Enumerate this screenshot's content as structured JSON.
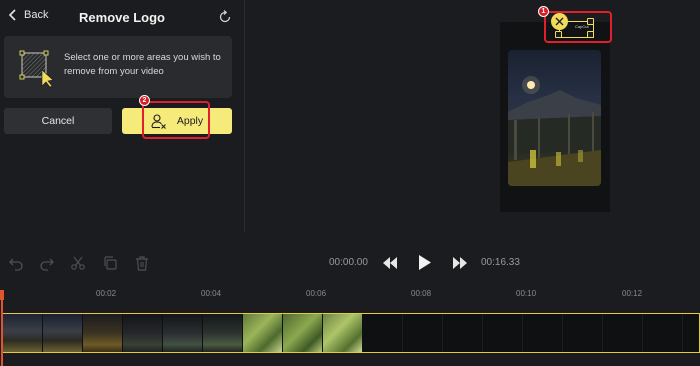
{
  "header": {
    "back_label": "Back",
    "title": "Remove Logo"
  },
  "info": {
    "text": "Select one or more areas you wish to remove from your video"
  },
  "buttons": {
    "cancel_label": "Cancel",
    "apply_label": "Apply"
  },
  "annotations": {
    "badge_1": "1",
    "badge_2": "2"
  },
  "preview": {
    "logo_text": "CapCut"
  },
  "playback": {
    "current_time": "00:00.00",
    "total_time": "00:16.33"
  },
  "ruler": {
    "labels": [
      "00:02",
      "00:04",
      "00:06",
      "00:08",
      "00:10",
      "00:12"
    ]
  },
  "colors": {
    "accent": "#f6ea7a",
    "highlight": "#e0202a",
    "playhead": "#e0552a",
    "track_border": "#e8c93a",
    "background": "#1b1c1f"
  },
  "icons": {
    "back": "chevron-left-icon",
    "reset": "refresh-icon",
    "area": "area-select-icon",
    "apply": "user-remove-icon",
    "undo": "undo-icon",
    "redo": "redo-icon",
    "cut": "scissors-icon",
    "copy": "copy-icon",
    "delete": "trash-icon",
    "rewind": "rewind-icon",
    "play": "play-icon",
    "forward": "fast-forward-icon",
    "close": "close-icon"
  }
}
